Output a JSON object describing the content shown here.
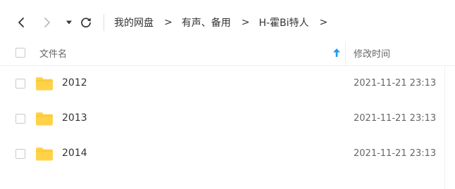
{
  "toolbar": {
    "back_icon": "chevron-left-icon",
    "forward_icon": "chevron-right-icon",
    "dropdown_icon": "caret-down-icon",
    "refresh_icon": "refresh-icon"
  },
  "breadcrumb": {
    "items": [
      "我的网盘",
      "有声、备用",
      "H-霍Bi特人"
    ],
    "separator": ">"
  },
  "table": {
    "columns": {
      "name": "文件名",
      "modified": "修改时间"
    },
    "sort_indicator": "arrow-up-icon",
    "rows": [
      {
        "name": "2012",
        "modified": "2021-11-21 23:13",
        "icon": "folder-icon"
      },
      {
        "name": "2013",
        "modified": "2021-11-21 23:13",
        "icon": "folder-icon"
      },
      {
        "name": "2014",
        "modified": "2021-11-21 23:13",
        "icon": "folder-icon"
      }
    ]
  },
  "colors": {
    "folder": "#FFD248",
    "sort_arrow": "#1E9BF0",
    "text": "#333333",
    "muted": "#666666",
    "border": "#EEEEEE"
  }
}
